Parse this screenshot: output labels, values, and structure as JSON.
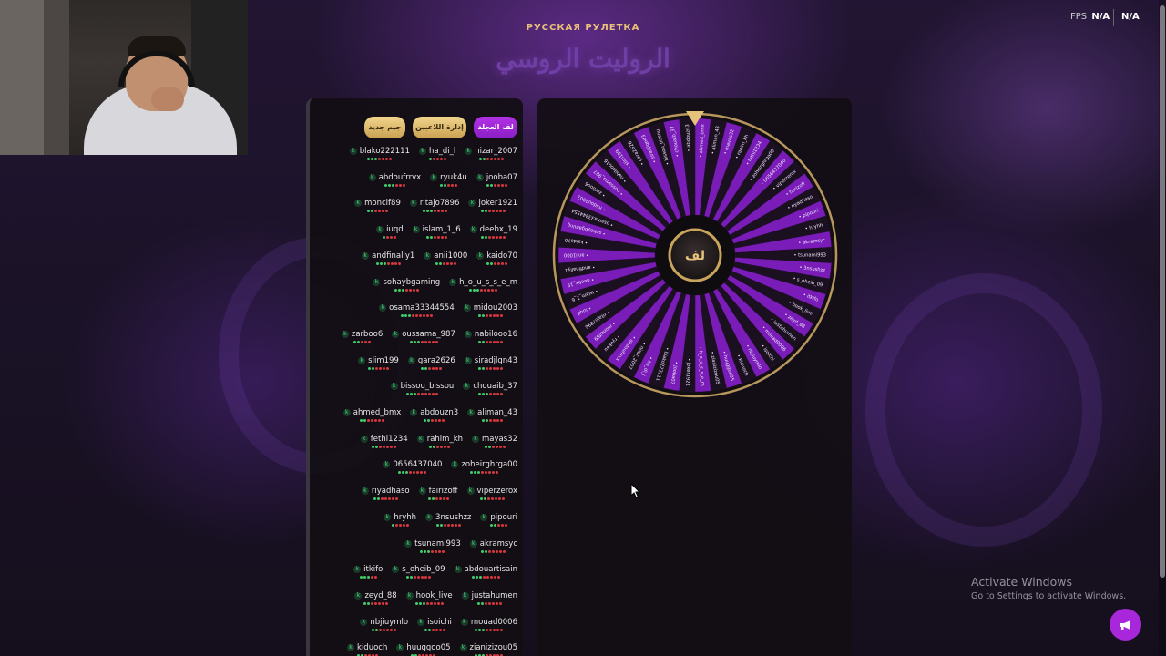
{
  "header": {
    "subtitle": "РУССКАЯ РУЛЕТКА",
    "title": "الروليت الروسي",
    "fps_label": "FPS",
    "fps_value": "N/A",
    "fps_chip": "N/A"
  },
  "buttons": {
    "new_game": "جيم جديد",
    "manage_players": "إدارة اللاعبين",
    "spin_wheel": "لف العجلة"
  },
  "wheel": {
    "center_label": "لف",
    "segments": [
      "ahmed_bmx",
      "aliman_43",
      "mayas32",
      "rahim_kh",
      "fethi1234",
      "zoheirghrga00",
      "0656437040",
      "viperzerox",
      "fairizoff",
      "riyadhaso",
      "pipouri",
      "hryhh",
      "akramsyc",
      "tsunami993",
      "3nsushzz",
      "s_oheib_09",
      "itkifo",
      "hook_live",
      "zeyd_88",
      "justahumen",
      "mouad0006",
      "isoichi",
      "nbjiuymlo",
      "kiduoch",
      "huuggoo05",
      "zianizizou05",
      "h_o_u_s_s_e_m",
      "joker1921",
      "jooba07",
      "blako222111",
      "ha_di_l",
      "nizar_2007",
      "abdoufrrvx",
      "ryuk4u",
      "moncif89",
      "ritajo7896",
      "iuqd",
      "islam_1_6",
      "deebx_19",
      "andfinally1",
      "anii1000",
      "kaido70",
      "sohaybgaming",
      "osama33344554",
      "midou2003",
      "zarboo6",
      "oussama_987",
      "nabilooo16",
      "slim199",
      "gara2626",
      "siradjlgn43",
      "bissou_bissou",
      "chouaib_37",
      "abdouzn3"
    ]
  },
  "player_rows": [
    [
      {
        "n": "blako222111",
        "d": "gggrrrr"
      },
      {
        "n": "ha_di_l",
        "d": "grrrr"
      },
      {
        "n": "nizar_2007",
        "d": "ggrrrrr"
      }
    ],
    [
      {
        "n": "abdoufrrvx",
        "d": "gggrrr"
      },
      {
        "n": "ryuk4u",
        "d": "ggrrr"
      },
      {
        "n": "jooba07",
        "d": "ggrrrr"
      }
    ],
    [
      {
        "n": "moncif89",
        "d": "ggrrrr"
      },
      {
        "n": "ritajo7896",
        "d": "gggrrrr"
      },
      {
        "n": "joker1921",
        "d": "ggrrrrr"
      }
    ],
    [
      {
        "n": "iuqd",
        "d": "grrr"
      },
      {
        "n": "islam_1_6",
        "d": "ggrrrr"
      },
      {
        "n": "deebx_19",
        "d": "ggrrrrr"
      }
    ],
    [
      {
        "n": "andfinally1",
        "d": "gggrrrr"
      },
      {
        "n": "anii1000",
        "d": "ggrrrr"
      },
      {
        "n": "kaido70",
        "d": "ggrrrr"
      }
    ],
    [
      {
        "n": "sohaybgaming",
        "d": "gggrrrr"
      },
      {
        "n": "h_o_u_s_s_e_m",
        "d": "gggrrrrr"
      }
    ],
    [
      {
        "n": "osama33344554",
        "d": "gggrrrrrr"
      },
      {
        "n": "midou2003",
        "d": "ggrrrrr"
      }
    ],
    [
      {
        "n": "zarboo6",
        "d": "ggrrr"
      },
      {
        "n": "oussama_987",
        "d": "gggrrrrr"
      },
      {
        "n": "nabilooo16",
        "d": "ggrrrrr"
      }
    ],
    [
      {
        "n": "slim199",
        "d": "ggrrrr"
      },
      {
        "n": "gara2626",
        "d": "ggrrrr"
      },
      {
        "n": "siradjlgn43",
        "d": "ggrrrrr"
      }
    ],
    [
      {
        "n": "bissou_bissou",
        "d": "gggrrrrrr"
      },
      {
        "n": "chouaib_37",
        "d": "gggrrrr"
      }
    ],
    [
      {
        "n": "ahmed_bmx",
        "d": "ggrrrrr"
      },
      {
        "n": "abdouzn3",
        "d": "ggrrrr"
      },
      {
        "n": "aliman_43",
        "d": "ggrrrr"
      }
    ],
    [
      {
        "n": "fethi1234",
        "d": "ggrrrrr"
      },
      {
        "n": "rahim_kh",
        "d": "ggrrrr"
      },
      {
        "n": "mayas32",
        "d": "ggrrrr"
      }
    ],
    [
      {
        "n": "0656437040",
        "d": "gggrrrrr"
      },
      {
        "n": "zoheirghrga00",
        "d": "gggrrrrr"
      }
    ],
    [
      {
        "n": "riyadhaso",
        "d": "ggrrrrr"
      },
      {
        "n": "fairizoff",
        "d": "ggrrrr"
      },
      {
        "n": "viperzerox",
        "d": "ggrrrrr"
      }
    ],
    [
      {
        "n": "hryhh",
        "d": "grrrr"
      },
      {
        "n": "3nsushzz",
        "d": "ggrrrrr"
      },
      {
        "n": "pipouri",
        "d": "ggrrr"
      }
    ],
    [
      {
        "n": "tsunami993",
        "d": "gggrrrr"
      },
      {
        "n": "akramsyc",
        "d": "ggrrrrr"
      }
    ],
    [
      {
        "n": "itkifo",
        "d": "gggrr"
      },
      {
        "n": "s_oheib_09",
        "d": "ggrrrrr"
      },
      {
        "n": "abdouartisain",
        "d": "gggrrrrr"
      }
    ],
    [
      {
        "n": "zeyd_88",
        "d": "ggrrrrr"
      },
      {
        "n": "hook_live",
        "d": "gggrrrrr"
      },
      {
        "n": "justahumen",
        "d": "ggrrrrr"
      }
    ],
    [
      {
        "n": "nbjiuymlo",
        "d": "ggrrrrr"
      },
      {
        "n": "isoichi",
        "d": "ggrrrr"
      },
      {
        "n": "mouad0006",
        "d": "gggrrrrr"
      }
    ],
    [
      {
        "n": "kiduoch",
        "d": "ggrrrr"
      },
      {
        "n": "huuggoo05",
        "d": "ggrrrrr"
      },
      {
        "n": "zianizizou05",
        "d": "gggrrrrr"
      }
    ]
  ],
  "windows": {
    "activate_title": "Activate Windows",
    "activate_sub": "Go to Settings to activate Windows."
  },
  "colors": {
    "accent_purple": "#a827db",
    "gold": "#d9b46a",
    "status_green": "#3ecf6a",
    "status_red": "#d8383e"
  }
}
